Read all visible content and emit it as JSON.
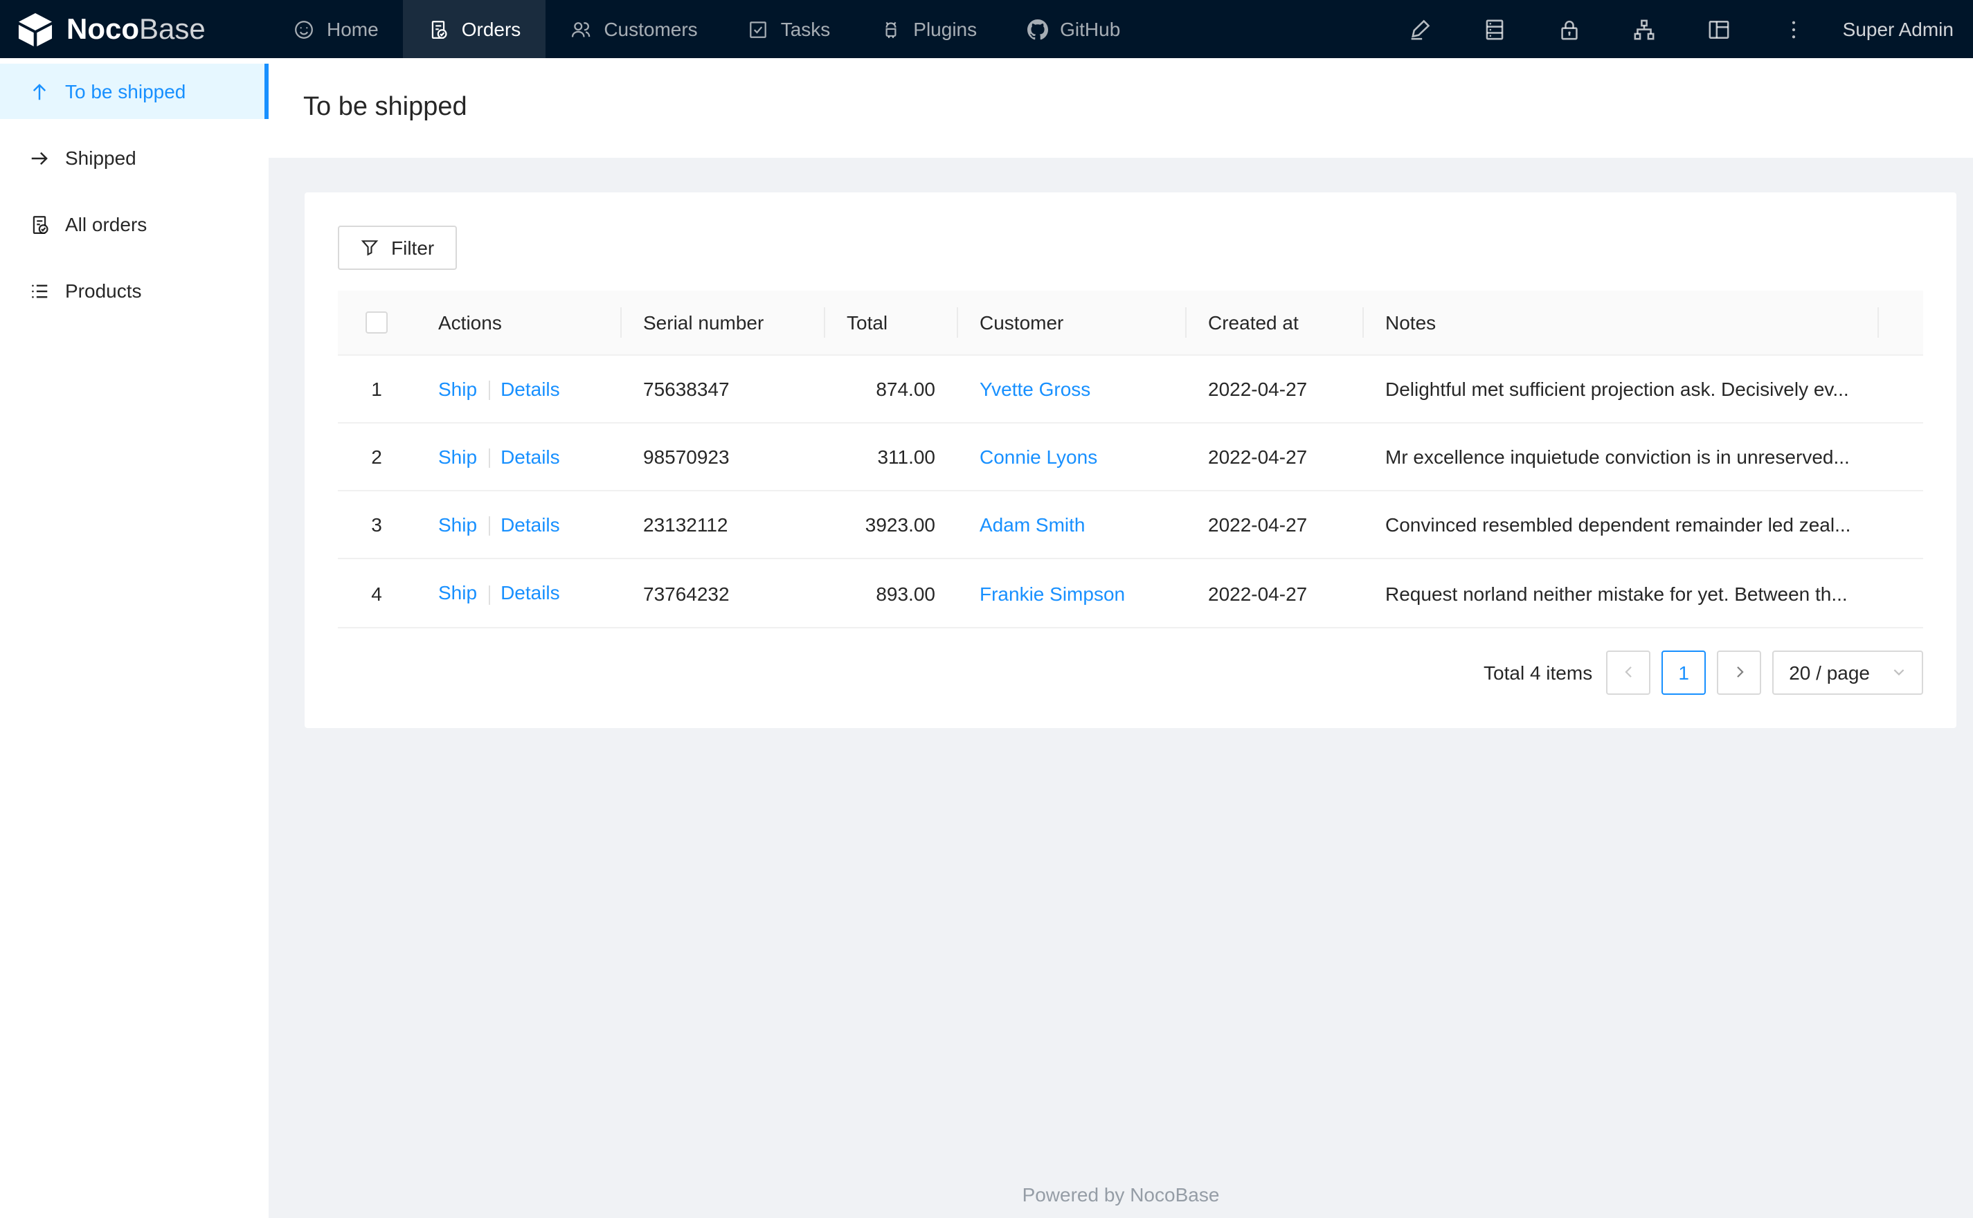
{
  "navbar": {
    "logo": {
      "noco": "Noco",
      "base": "Base"
    },
    "items": [
      {
        "label": "Home",
        "icon": "smile-icon",
        "active": false
      },
      {
        "label": "Orders",
        "icon": "file-done-icon",
        "active": true
      },
      {
        "label": "Customers",
        "icon": "team-icon",
        "active": false
      },
      {
        "label": "Tasks",
        "icon": "check-square-icon",
        "active": false
      },
      {
        "label": "Plugins",
        "icon": "android-icon",
        "active": false
      },
      {
        "label": "GitHub",
        "icon": "github-icon",
        "active": false
      }
    ],
    "right_icons": [
      "highlight-icon",
      "database-icon",
      "lock-icon",
      "apartment-icon",
      "layout-icon",
      "ellipsis-vertical-icon"
    ],
    "user": "Super Admin"
  },
  "sidebar": {
    "items": [
      {
        "label": "To be shipped",
        "icon": "arrow-up-icon",
        "active": true
      },
      {
        "label": "Shipped",
        "icon": "arrow-right-icon",
        "active": false
      },
      {
        "label": "All orders",
        "icon": "file-done-icon",
        "active": false
      },
      {
        "label": "Products",
        "icon": "unordered-list-icon",
        "active": false
      }
    ]
  },
  "page": {
    "title": "To be shipped"
  },
  "toolbar": {
    "filter_label": "Filter"
  },
  "table": {
    "columns": [
      "",
      "Actions",
      "Serial number",
      "Total",
      "Customer",
      "Created at",
      "Notes"
    ],
    "action_labels": [
      "Ship",
      "Details"
    ],
    "rows": [
      {
        "index": "1",
        "serial": "75638347",
        "total": "874.00",
        "customer": "Yvette Gross",
        "created_at": "2022-04-27",
        "notes": "Delightful met sufficient projection ask. Decisively ev..."
      },
      {
        "index": "2",
        "serial": "98570923",
        "total": "311.00",
        "customer": "Connie Lyons",
        "created_at": "2022-04-27",
        "notes": "Mr excellence inquietude conviction is in unreserved..."
      },
      {
        "index": "3",
        "serial": "23132112",
        "total": "3923.00",
        "customer": "Adam Smith",
        "created_at": "2022-04-27",
        "notes": "Convinced resembled dependent remainder led zeal..."
      },
      {
        "index": "4",
        "serial": "73764232",
        "total": "893.00",
        "customer": "Frankie Simpson",
        "created_at": "2022-04-27",
        "notes": "Request norland neither mistake for yet. Between th..."
      }
    ]
  },
  "pagination": {
    "total_text": "Total 4 items",
    "current_page": "1",
    "page_size": "20 / page"
  },
  "footer": {
    "text": "Powered by NocoBase"
  },
  "colors": {
    "accent": "#1890ff",
    "navbar_bg": "#001529",
    "navbar_active_bg": "#1a2c3e",
    "content_bg": "#f0f2f5",
    "sidebar_active_bg": "#e6f7ff"
  }
}
